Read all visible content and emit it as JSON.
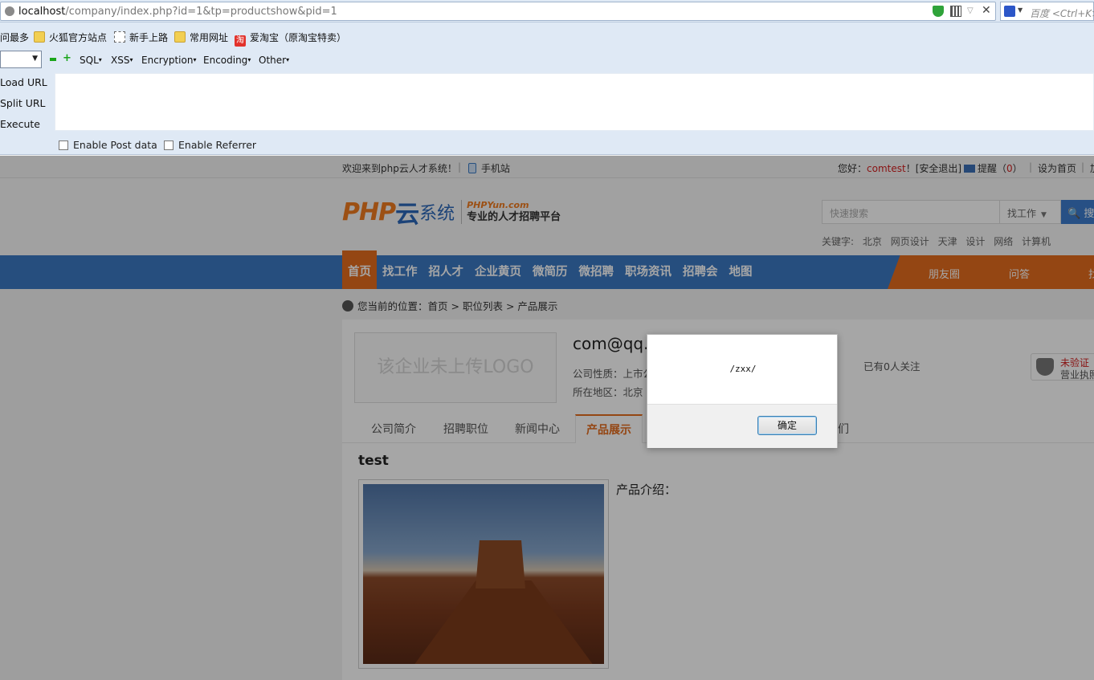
{
  "browser": {
    "url_host": "localhost",
    "url_path": "/company/index.php?id=1&tp=productshow&pid=1",
    "search_placeholder": "百度 <Ctrl+K>",
    "bookmarks": [
      {
        "label": "问最多",
        "icon": "none"
      },
      {
        "label": "火狐官方站点",
        "icon": "folder-icon"
      },
      {
        "label": "新手上路",
        "icon": "page-icon"
      },
      {
        "label": "常用网址",
        "icon": "folder-icon"
      },
      {
        "label": "爱淘宝（原淘宝特卖）",
        "icon": "taobao-icon"
      }
    ]
  },
  "hackbar": {
    "menus": [
      "SQL",
      "XSS",
      "Encryption",
      "Encoding",
      "Other"
    ],
    "actions": [
      "Load URL",
      "Split URL",
      "Execute"
    ],
    "checkboxes": [
      "Enable Post data",
      "Enable Referrer"
    ]
  },
  "site": {
    "topbar": {
      "welcome": "欢迎来到php云人才系统！",
      "mobile": "手机站",
      "hello": "您好：",
      "user": "comtest",
      "logout": "！[安全退出]",
      "remind": "提醒（",
      "remind_count": "0",
      "remind_close": "）",
      "set_home": "设为首页",
      "more": "加"
    },
    "logo": {
      "php": "PHP",
      "yun": "云",
      "sys": "系统",
      "tagline_en": "PHPYun.com",
      "tagline_cn": "专业的人才招聘平台"
    },
    "search": {
      "placeholder": "快速搜索",
      "type": "找工作",
      "button": "搜"
    },
    "keywords_label": "关键字:",
    "keywords": [
      "北京",
      "网页设计",
      "天津",
      "设计",
      "网络",
      "计算机"
    ],
    "nav": [
      "首页",
      "找工作",
      "招人才",
      "企业黄页",
      "微简历",
      "微招聘",
      "职场资讯",
      "招聘会",
      "地图"
    ],
    "nav_right": [
      "朋友圈",
      "问答",
      "找"
    ],
    "breadcrumb": {
      "prefix": "您当前的位置：",
      "items": [
        "首页",
        "职位列表",
        "产品展示"
      ]
    },
    "company": {
      "logo_placeholder": "该企业未上传LOGO",
      "name": "com@qq.",
      "nature": "公司性质：上市公",
      "area": "所在地区：北京",
      "followers": "已有0人关注",
      "verify_status": "未验证",
      "verify_sub": "营业执照"
    },
    "tabs": [
      "公司简介",
      "招聘职位",
      "新闻中心",
      "产品展示",
      "们"
    ],
    "product": {
      "title": "test",
      "intro_label": "产品介绍："
    }
  },
  "alert": {
    "message": "/zxx/",
    "ok_label": "确定"
  }
}
